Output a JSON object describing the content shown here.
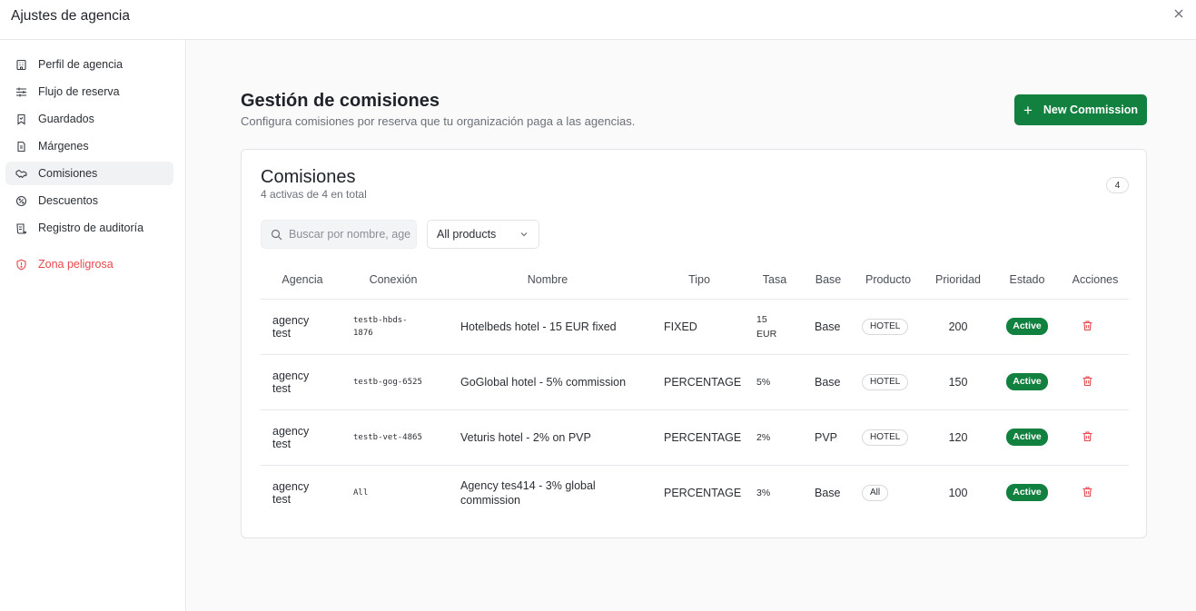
{
  "header": {
    "title": "Ajustes de agencia"
  },
  "sidebar": {
    "items": [
      {
        "label": "Perfil de agencia",
        "icon": "building-icon"
      },
      {
        "label": "Flujo de reserva",
        "icon": "sliders-icon"
      },
      {
        "label": "Guardados",
        "icon": "bookmark-icon"
      },
      {
        "label": "Márgenes",
        "icon": "document-icon"
      },
      {
        "label": "Comisiones",
        "icon": "handshake-icon",
        "active": true
      },
      {
        "label": "Descuentos",
        "icon": "percent-badge-icon"
      },
      {
        "label": "Registro de auditoría",
        "icon": "scroll-icon"
      }
    ],
    "danger": {
      "label": "Zona peligrosa",
      "icon": "shield-alert-icon"
    }
  },
  "main": {
    "title": "Gestión de comisiones",
    "subtitle": "Configura comisiones por reserva que tu organización paga a las agencias.",
    "new_button": "New Commission"
  },
  "card": {
    "title": "Comisiones",
    "subtitle": "4 activas de 4 en total",
    "count": "4",
    "search_placeholder": "Buscar por nombre, agencia...",
    "product_filter": "All products",
    "columns": [
      "Agencia",
      "Conexión",
      "Nombre",
      "Tipo",
      "Tasa",
      "Base",
      "Producto",
      "Prioridad",
      "Estado",
      "Acciones"
    ],
    "rows": [
      {
        "agency": "agency test",
        "connection": "testb-hbds-1876",
        "name": "Hotelbeds hotel - 15 EUR fixed",
        "type": "FIXED",
        "rate": "15 EUR",
        "base": "Base",
        "product": "HOTEL",
        "priority": "200",
        "status": "Active"
      },
      {
        "agency": "agency test",
        "connection": "testb-gog-6525",
        "name": "GoGlobal hotel - 5% commission",
        "type": "PERCENTAGE",
        "rate": "5%",
        "base": "Base",
        "product": "HOTEL",
        "priority": "150",
        "status": "Active"
      },
      {
        "agency": "agency test",
        "connection": "testb-vet-4865",
        "name": "Veturis hotel - 2% on PVP",
        "type": "PERCENTAGE",
        "rate": "2%",
        "base": "PVP",
        "product": "HOTEL",
        "priority": "120",
        "status": "Active"
      },
      {
        "agency": "agency test",
        "connection": "All",
        "name": "Agency tes414 - 3% global commission",
        "type": "PERCENTAGE",
        "rate": "3%",
        "base": "Base",
        "product": "All",
        "priority": "100",
        "status": "Active"
      }
    ]
  },
  "colors": {
    "accent": "#12803e",
    "danger": "#e5484d"
  }
}
